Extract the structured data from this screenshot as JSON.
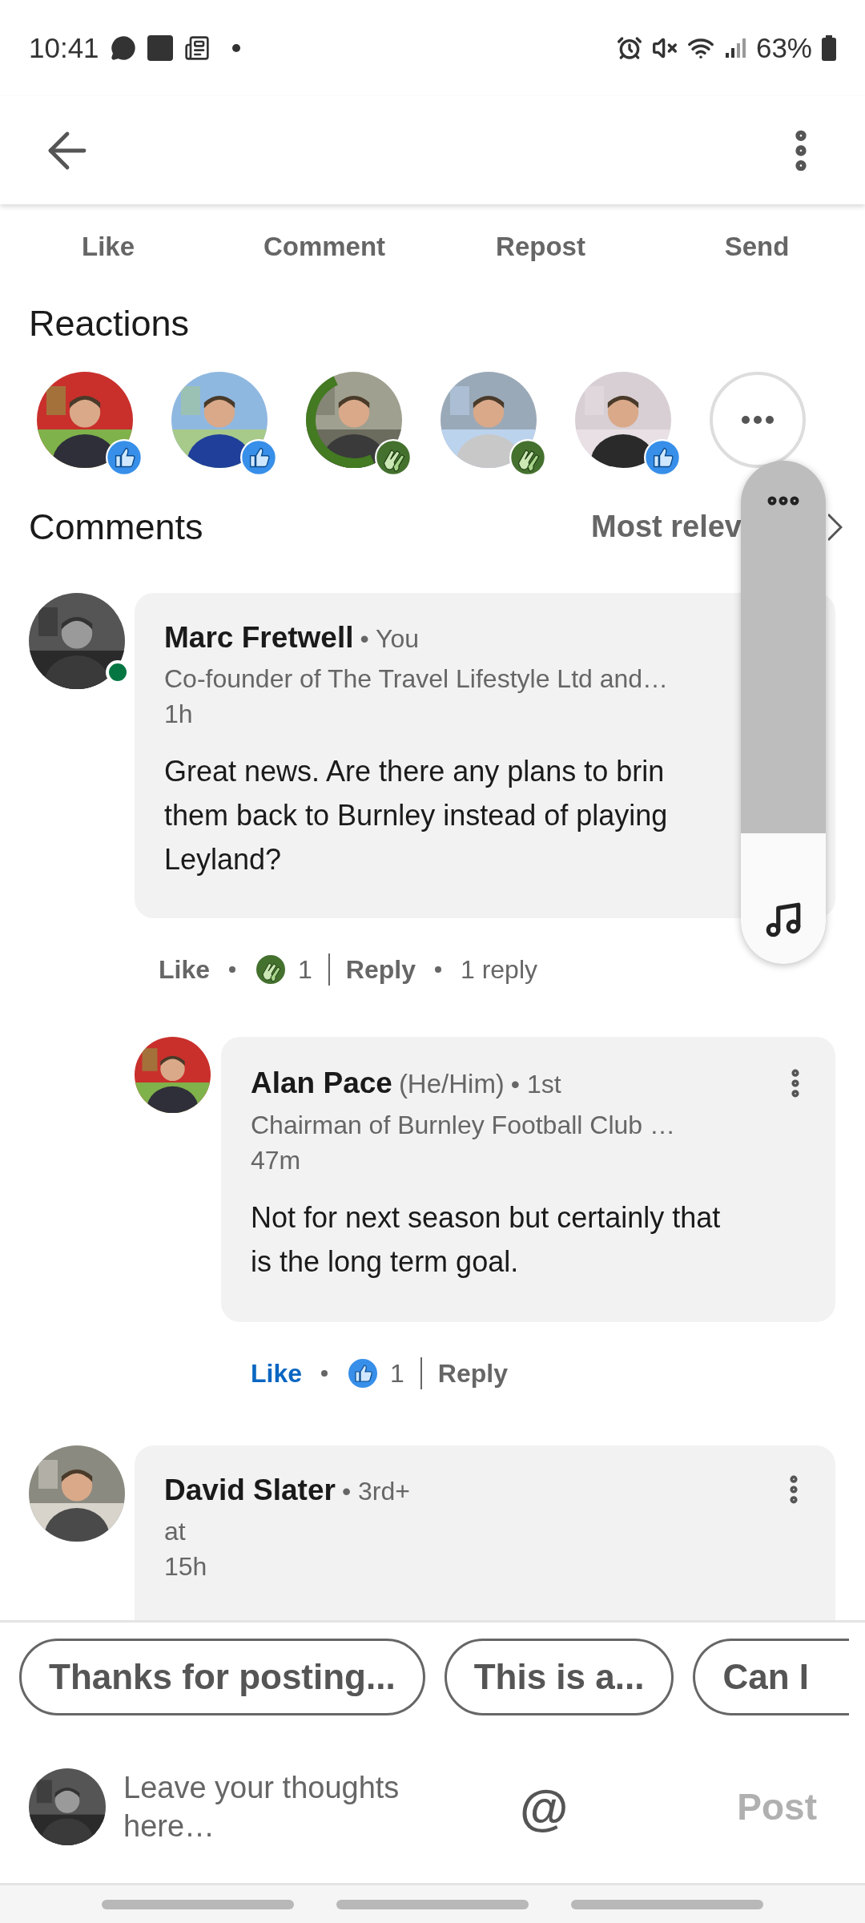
{
  "status_bar": {
    "time": "10:41",
    "battery": "63%"
  },
  "post_actions": [
    "Like",
    "Comment",
    "Repost",
    "Send"
  ],
  "reactions": {
    "title": "Reactions",
    "people": [
      {
        "kind": "like",
        "open_to_work": false
      },
      {
        "kind": "like",
        "open_to_work": false
      },
      {
        "kind": "celebrate",
        "open_to_work": true
      },
      {
        "kind": "celebrate",
        "open_to_work": false
      },
      {
        "kind": "like",
        "open_to_work": false
      }
    ]
  },
  "comments_header": {
    "title": "Comments",
    "sort": "Most relev"
  },
  "comments": [
    {
      "author": "Marc Fretwell",
      "degree": "• You",
      "headline": "Co-founder of The Travel Lifestyle Ltd and…",
      "time": "1h",
      "online": true,
      "menu": false,
      "body_lines": [
        "Great news. Are there any plans to brin",
        "them back to Burnley instead of playing",
        "Leyland?"
      ],
      "like_label": "Like",
      "liked": false,
      "reaction": {
        "kind": "celebrate",
        "count": "1"
      },
      "reply_label": "Reply",
      "reply_count": "1 reply",
      "replies": [
        {
          "author": "Alan Pace",
          "pronouns": "(He/Him)",
          "degree": "• 1st",
          "headline": "Chairman of Burnley Football Club …",
          "time": "47m",
          "online": false,
          "menu": true,
          "body_lines": [
            "Not for next season but certainly that",
            "is the long term goal."
          ],
          "like_label": "Like",
          "liked": true,
          "reaction": {
            "kind": "like",
            "count": "1"
          },
          "reply_label": "Reply"
        }
      ]
    },
    {
      "author": "David Slater",
      "degree": "• 3rd+",
      "headline": "at",
      "time": "15h",
      "online": false,
      "menu": true
    }
  ],
  "suggestions": [
    "Thanks for posting...",
    "This is a...",
    "Can I"
  ],
  "composer": {
    "placeholder": "Leave your thoughts here…",
    "mention": "@",
    "post": "Post",
    "post_disabled": true
  },
  "volume": {
    "level": 0.26
  }
}
